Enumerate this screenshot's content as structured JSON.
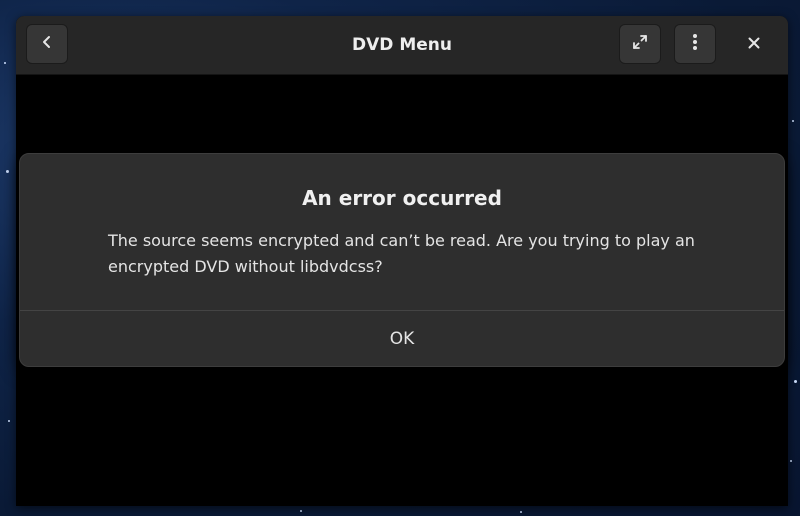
{
  "window": {
    "title": "DVD Menu"
  },
  "headerbar": {
    "back_icon": "chevron-left-icon",
    "fullscreen_icon": "fullscreen-icon",
    "menu_icon": "vertical-ellipsis-icon",
    "close_icon": "close-icon"
  },
  "dialog": {
    "title": "An error occurred",
    "message": "The source seems encrypted and can’t be read. Are you trying to play an encrypted DVD without libdvdcss?",
    "ok_label": "OK"
  },
  "colors": {
    "headerbar_bg": "#262626",
    "dialog_bg": "#2e2e2e",
    "video_bg": "#000000",
    "desktop_bg": "#0f2448"
  }
}
